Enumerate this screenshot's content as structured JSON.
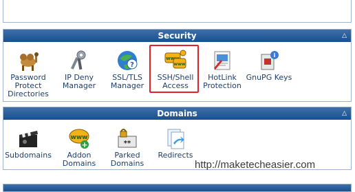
{
  "security": {
    "title": "Security",
    "items": [
      {
        "label": "Password Protect Directories",
        "icon": "camel-icon"
      },
      {
        "label": "IP Deny Manager",
        "icon": "keys-icon"
      },
      {
        "label": "SSL/TLS Manager",
        "icon": "ssl-globe-icon"
      },
      {
        "label": "SSH/Shell Access",
        "icon": "ssh-www-icon"
      },
      {
        "label": "HotLink Protection",
        "icon": "hotlink-icon"
      },
      {
        "label": "GnuPG Keys",
        "icon": "gnupg-key-icon"
      }
    ]
  },
  "domains": {
    "title": "Domains",
    "items": [
      {
        "label": "Subdomains",
        "icon": "clapper-icon"
      },
      {
        "label": "Addon Domains",
        "icon": "www-add-icon"
      },
      {
        "label": "Parked Domains",
        "icon": "parked-lock-icon"
      },
      {
        "label": "Redirects",
        "icon": "redirect-icon"
      }
    ]
  },
  "watermark": "http://maketecheasier.com",
  "colors": {
    "header": "#19508f",
    "highlight": "#e0202a",
    "link": "#1d3f6b"
  }
}
